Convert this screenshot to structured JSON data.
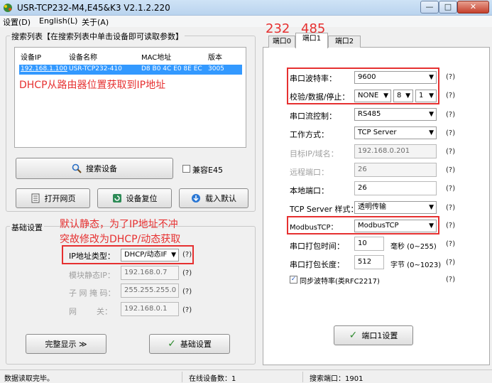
{
  "window": {
    "title": "USR-TCP232-M4,E45&K3 V2.1.2.220",
    "min": "—",
    "max": "□",
    "close": "✕"
  },
  "menu": [
    "设置(D)",
    "English(L)",
    "关于(A)"
  ],
  "search": {
    "group_label": "搜索列表【在搜索列表中单击设备即可读取参数】",
    "columns": [
      "设备IP",
      "设备名称",
      "MAC地址",
      "版本"
    ],
    "rows": [
      {
        "ip": "192.168.1.100",
        "name": "USR-TCP232-410",
        "mac": "D8 B0 4C E0 8E EC",
        "version": "3005"
      }
    ],
    "annotation": "DHCP从路由器位置获取到IP地址",
    "search_button": "搜索设备",
    "compat_label": "兼容E45",
    "open_web_button": "打开网页",
    "reset_button": "设备复位",
    "load_default_button": "载入默认"
  },
  "basic": {
    "group_label": "基础设置",
    "annotation_line1": "默认静态，为了IP地址不冲",
    "annotation_line2": "突故修改为DHCP/动态获取",
    "ip_type_label": "IP地址类型：",
    "ip_type_value": "DHCP/动态IF",
    "static_ip_label": "模块静态IP：",
    "static_ip_value": "192.168.0.7",
    "mask_label": "子 网 掩 码：",
    "mask_value": "255.255.255.0",
    "gateway_label": "网        关：",
    "gateway_value": "192.168.0.1",
    "full_display_button": "完整显示 ≫",
    "basic_settings_button": "基础设置"
  },
  "tabs": {
    "items": [
      "端口0",
      "端口1",
      "端口2"
    ],
    "active_index": 1,
    "annotation_232": "232",
    "annotation_485": "485"
  },
  "port": {
    "baud_label": "串口波特率：",
    "baud_value": "9600",
    "parity_label": "校验/数据/停止：",
    "parity_value": "NONE",
    "databits_value": "8",
    "stopbits_value": "1",
    "flow_label": "串口流控制：",
    "flow_value": "RS485",
    "mode_label": "工作方式：",
    "mode_value": "TCP Server",
    "target_label": "目标IP/域名：",
    "target_value": "192.168.0.201",
    "remote_port_label": "远程端口：",
    "remote_port_value": "26",
    "local_port_label": "本地端口：",
    "local_port_value": "26",
    "tcp_style_label": "TCP Server 样式：",
    "tcp_style_value": "透明传输",
    "modbus_label": "ModbusTCP：",
    "modbus_value": "ModbusTCP",
    "pack_time_label": "串口打包时间：",
    "pack_time_value": "10",
    "pack_time_unit": "毫秒 (0~255)",
    "pack_len_label": "串口打包长度：",
    "pack_len_value": "512",
    "pack_len_unit": "字节 (0~1023)",
    "sync_baud_label": "同步波特率(类RFC2217)",
    "help": "(?)",
    "port1_settings_button": "端口1设置"
  },
  "status": {
    "message": "数据读取完毕。",
    "online": "在线设备数：1",
    "search_port": "搜索端口：1901"
  }
}
